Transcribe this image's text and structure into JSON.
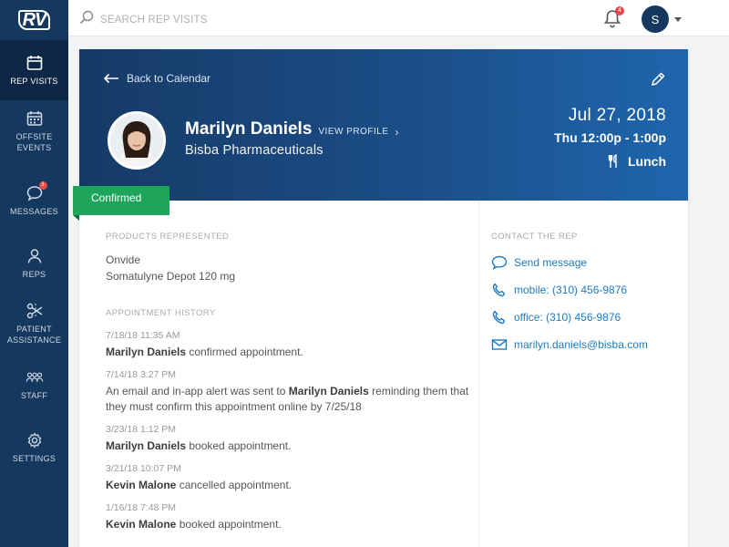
{
  "brand": {
    "logo_text": "RV"
  },
  "sidebar": {
    "items": [
      {
        "label": "REP VISITS",
        "icon": "calendar-icon",
        "active": true
      },
      {
        "label": "OFFSITE EVENTS",
        "icon": "calendar-grid-icon"
      },
      {
        "label": "MESSAGES",
        "icon": "chat-bubble-icon",
        "badge": "3"
      },
      {
        "label": "REPS",
        "icon": "person-icon"
      },
      {
        "label": "PATIENT ASSISTANCE",
        "icon": "scissors-icon"
      },
      {
        "label": "STAFF",
        "icon": "people-group-icon"
      },
      {
        "label": "SETTINGS",
        "icon": "gear-icon"
      }
    ]
  },
  "topbar": {
    "search_placeholder": "SEARCH REP VISITS",
    "notifications_count": "4",
    "user_initial": "S"
  },
  "visit": {
    "back_label": "Back to Calendar",
    "rep_name": "Marilyn Daniels",
    "view_profile_label": "VIEW PROFILE",
    "company": "Bisba Pharmaceuticals",
    "date": "Jul 27, 2018",
    "time": "Thu 12:00p - 1:00p",
    "meal": "Lunch",
    "status": "Confirmed",
    "status_color": "#1fa45b"
  },
  "products": {
    "heading": "PRODUCTS REPRESENTED",
    "items": [
      "Onvide",
      "Somatulyne Depot 120 mg"
    ]
  },
  "history": {
    "heading": "APPOINTMENT HISTORY",
    "entries": [
      {
        "ts": "7/18/18 11:35 AM",
        "name": "Marilyn Daniels",
        "pre": "",
        "post": " confirmed appointment."
      },
      {
        "ts": "7/14/18 3:27 PM",
        "pre": "An email and in-app alert was sent to ",
        "name": "Marilyn Daniels",
        "post": " reminding them that they must confirm this appointment online by 7/25/18"
      },
      {
        "ts": "3/23/18 1:12 PM",
        "name": "Marilyn Daniels",
        "pre": "",
        "post": " booked appointment."
      },
      {
        "ts": "3/21/18 10:07 PM",
        "name": "Kevin Malone",
        "pre": "",
        "post": " cancelled appointment."
      },
      {
        "ts": "1/16/18 7:48 PM",
        "name": "Kevin Malone",
        "pre": "",
        "post": " booked appointment."
      }
    ]
  },
  "contact": {
    "heading": "CONTACT THE REP",
    "send_message": "Send message",
    "mobile": "mobile: (310) 456-9876",
    "office": "office: (310) 456-9876",
    "email": "marilyn.daniels@bisba.com",
    "link_color": "#1f7bbf"
  },
  "colors": {
    "sidebar": "#15385f",
    "accent": "#1f66ad",
    "badge": "#e8474b"
  }
}
